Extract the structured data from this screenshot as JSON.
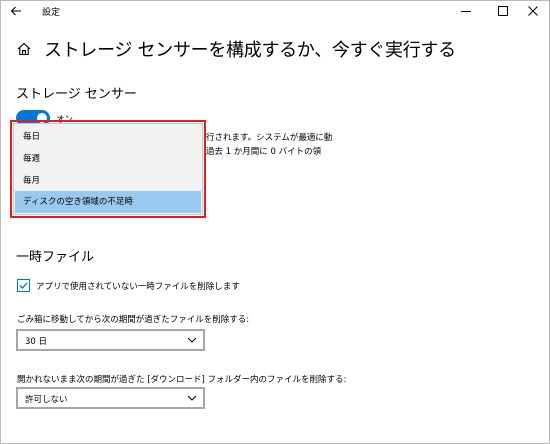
{
  "titlebar": {
    "app_title": "設定",
    "back_icon": "back-arrow-icon",
    "minimize_icon": "minimize-icon",
    "maximize_icon": "maximize-icon",
    "close_icon": "close-icon"
  },
  "header": {
    "home_icon": "home-icon",
    "title": "ストレージ センサーを構成するか、今すぐ実行する"
  },
  "storage_sense": {
    "title": "ストレージ センサー",
    "toggle_label": "オン",
    "toggle_on": true,
    "description_line1": "行されます。システムが最適に動",
    "description_line2": "過去 1 か月間に 0 バイトの領"
  },
  "run_dropdown": {
    "options": [
      "毎日",
      "毎週",
      "毎月",
      "ディスクの空き領域の不足時"
    ],
    "selected": "ディスクの空き領域の不足時"
  },
  "temp_files": {
    "title": "一時ファイル",
    "delete_unused_label": "アプリで使用されていない一時ファイルを削除します",
    "delete_unused_checked": true,
    "recycle_label": "ごみ箱に移動してから次の期間が過ぎたファイルを削除する:",
    "recycle_value": "30 日",
    "downloads_label": "開かれないまま次の期間が過ぎた [ダウンロード] フォルダー内のファイルを削除する:",
    "downloads_value": "許可しない"
  },
  "colors": {
    "accent": "#0078d7",
    "highlight_border": "#e02020",
    "selected_item": "#99c9ef"
  }
}
